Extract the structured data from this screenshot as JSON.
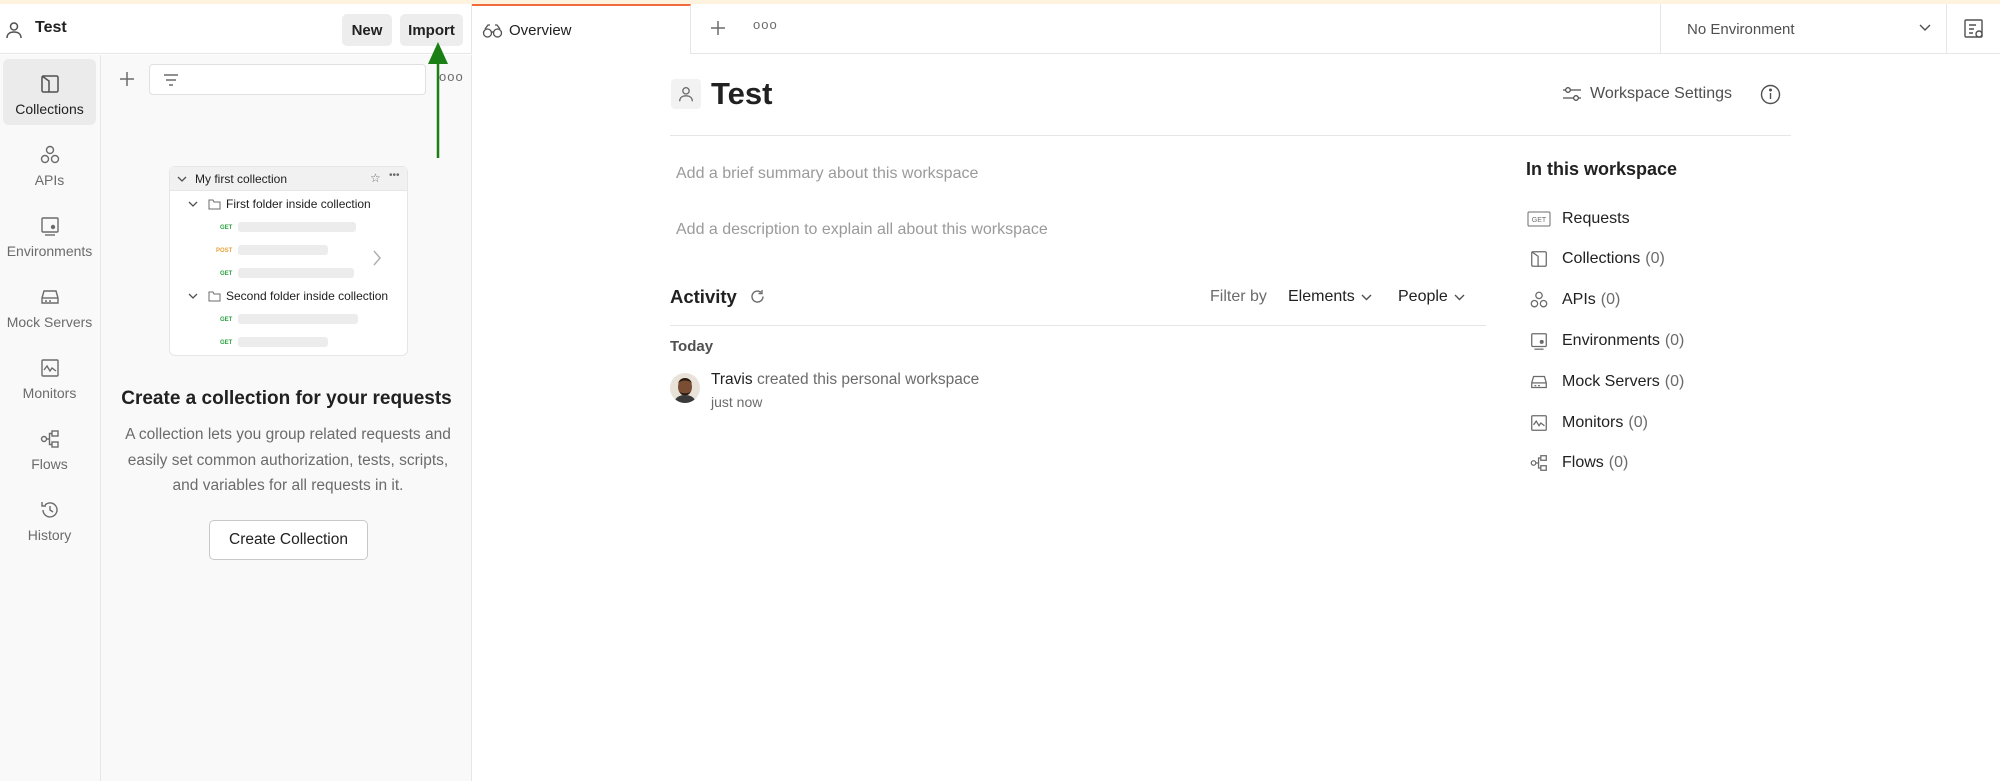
{
  "workspace": {
    "name": "Test"
  },
  "header": {
    "new_label": "New",
    "import_label": "Import"
  },
  "sidebar": {
    "items": [
      {
        "label": "Collections",
        "icon": "collections-icon",
        "active": true
      },
      {
        "label": "APIs",
        "icon": "apis-icon"
      },
      {
        "label": "Environments",
        "icon": "environments-icon"
      },
      {
        "label": "Mock Servers",
        "icon": "mock-servers-icon"
      },
      {
        "label": "Monitors",
        "icon": "monitors-icon"
      },
      {
        "label": "Flows",
        "icon": "flows-icon"
      },
      {
        "label": "History",
        "icon": "history-icon"
      }
    ]
  },
  "collections_pane": {
    "illustration": {
      "collection_name": "My first collection",
      "folder1": "First folder inside collection",
      "folder2": "Second folder inside collection",
      "methods": [
        "GET",
        "POST",
        "GET",
        "GET",
        "GET"
      ]
    },
    "empty_title": "Create a collection for your requests",
    "empty_desc": "A collection lets you group related requests and easily set common authorization, tests, scripts, and variables for all requests in it.",
    "create_button": "Create Collection"
  },
  "tabs": {
    "active_label": "Overview"
  },
  "environment": {
    "selected": "No Environment"
  },
  "overview": {
    "title": "Test",
    "settings_label": "Workspace Settings",
    "summary_placeholder": "Add a brief summary about this workspace",
    "description_placeholder": "Add a description to explain all about this workspace",
    "activity": {
      "title": "Activity",
      "filter_by": "Filter by",
      "elements_label": "Elements",
      "people_label": "People",
      "today_label": "Today",
      "entries": [
        {
          "user": "Travis",
          "action": "created this personal workspace",
          "time": "just now"
        }
      ]
    },
    "in_workspace": {
      "title": "In this workspace",
      "items": [
        {
          "label": "Requests",
          "count": ""
        },
        {
          "label": "Collections",
          "count": "(0)"
        },
        {
          "label": "APIs",
          "count": "(0)"
        },
        {
          "label": "Environments",
          "count": "(0)"
        },
        {
          "label": "Mock Servers",
          "count": "(0)"
        },
        {
          "label": "Monitors",
          "count": "(0)"
        },
        {
          "label": "Flows",
          "count": "(0)"
        }
      ]
    }
  },
  "colors": {
    "accent": "#f26b3a",
    "arrow": "#1a7f14"
  }
}
